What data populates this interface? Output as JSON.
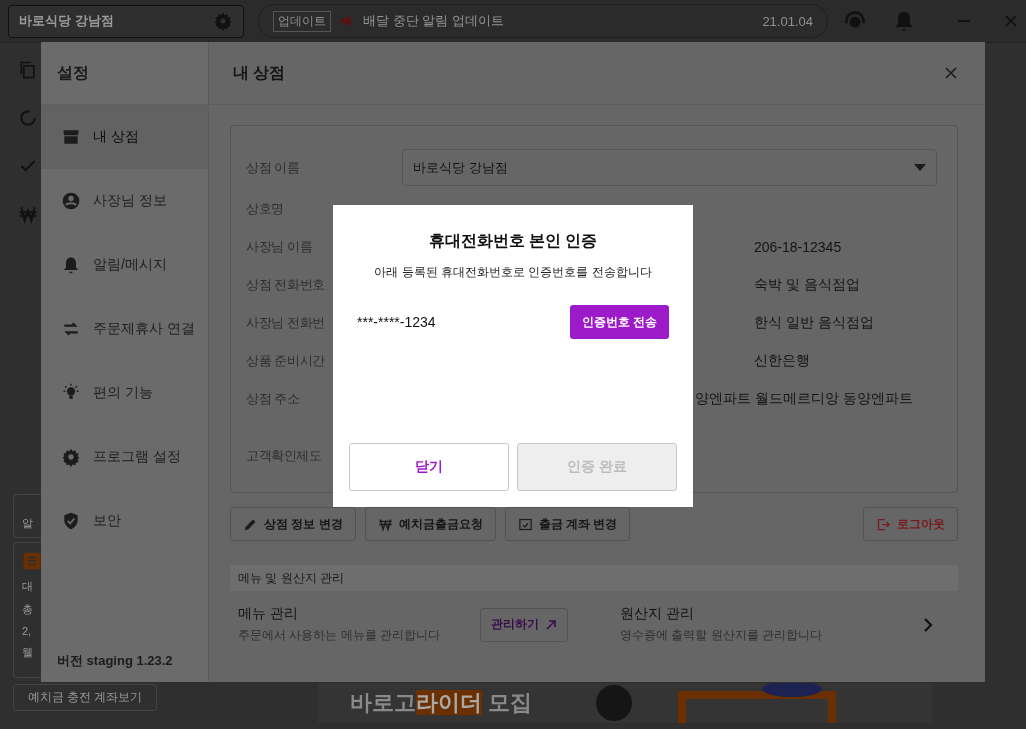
{
  "topbar": {
    "store": "바로식당 강남점",
    "notice_tag": "업데이트",
    "notice": "배달 중단 알림 업데이트",
    "notice_date": "21.01.04"
  },
  "background_card": {
    "tab": "알",
    "lines": [
      "대",
      "총",
      "2,",
      "웰"
    ],
    "button": "예치금 충전 계좌보기"
  },
  "banner": {
    "text": "바로고",
    "highlight": "라이더",
    "text_end": "모집"
  },
  "settings": {
    "title": "설정",
    "version": "버전 staging 1.23.2",
    "header": "내 상점",
    "nav": [
      {
        "label": "내 상점",
        "selected": true
      },
      {
        "label": "사장님 정보",
        "selected": false
      },
      {
        "label": "알림/메시지",
        "selected": false
      },
      {
        "label": "주문제휴사 연결",
        "selected": false
      },
      {
        "label": "편의 기능",
        "selected": false
      },
      {
        "label": "프로그램 설정",
        "selected": false
      },
      {
        "label": "보안",
        "selected": false
      }
    ],
    "fields": [
      {
        "kind": "select",
        "label": "상점 이름",
        "value": "바로식당 강남점"
      },
      {
        "kind": "text",
        "label": "상호명"
      },
      {
        "kind": "text",
        "label": "사장님 이름",
        "right_value": "206-18-12345"
      },
      {
        "kind": "text",
        "label": "상점 전화번호",
        "right_value": "숙박 및 음식점업"
      },
      {
        "kind": "text",
        "label": "사장님 전화번",
        "right_value": "한식 일반 음식점업"
      },
      {
        "kind": "text",
        "label": "상품 준비시간",
        "right_value": "신한은행"
      },
      {
        "kind": "address",
        "label": "상점 주소",
        "value": "양엔파트 월드메르디앙 동양엔파트"
      },
      {
        "kind": "tall",
        "label": "고객확인제도"
      }
    ],
    "actions": [
      "상점 정보 변경",
      "예치금출금요청",
      "출금 계좌 변경"
    ],
    "logout": "로그아웃",
    "section": "메뉴 및 원산지 관리",
    "menu_rows": [
      {
        "title": "메뉴 관리",
        "desc": "주문에서 사용하는 메뉴를 관리합니다",
        "button": "관리하기"
      },
      {
        "title": "원산지 관리",
        "desc": "영수증에 출력할 원산지를 관리합니다"
      }
    ]
  },
  "dialog": {
    "title": "휴대전화번호 본인 인증",
    "subtitle": "아래 등록된 휴대전화번호로 인증번호를 전송합니다",
    "phone": "***-****-1234",
    "send_button": "인증번호 전송",
    "buttons": [
      {
        "label": "닫기",
        "disabled": false
      },
      {
        "label": "인증 완료",
        "disabled": true
      }
    ]
  }
}
